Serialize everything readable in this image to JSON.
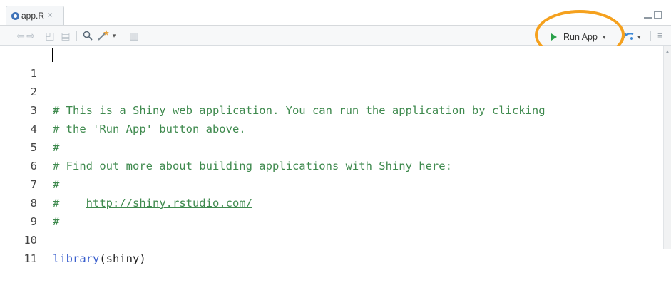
{
  "tab": {
    "filename": "app.R",
    "close": "×"
  },
  "toolbar": {
    "run_app_label": "Run App",
    "dropdown_glyph": "▾"
  },
  "editor": {
    "lines": [
      {
        "num": "1",
        "text": "#"
      },
      {
        "num": "2",
        "text": "# This is a Shiny web application. You can run the application by clicking"
      },
      {
        "num": "3",
        "text": "# the 'Run App' button above."
      },
      {
        "num": "4",
        "text": "#"
      },
      {
        "num": "5",
        "text": "# Find out more about building applications with Shiny here:"
      },
      {
        "num": "6",
        "text": "#"
      },
      {
        "num": "7",
        "prefix": "#    ",
        "link": "http://shiny.rstudio.com/"
      },
      {
        "num": "8",
        "text": "#"
      },
      {
        "num": "9",
        "text": ""
      },
      {
        "num": "10",
        "fn": "library",
        "open": "(",
        "arg": "shiny",
        "close": ")"
      },
      {
        "num": "11",
        "text": ""
      }
    ]
  },
  "colors": {
    "comment": "#3f8a4e",
    "keyword": "#3a5fcd",
    "run_icon": "#2aa14a",
    "highlight_ring": "#f5a11e"
  }
}
